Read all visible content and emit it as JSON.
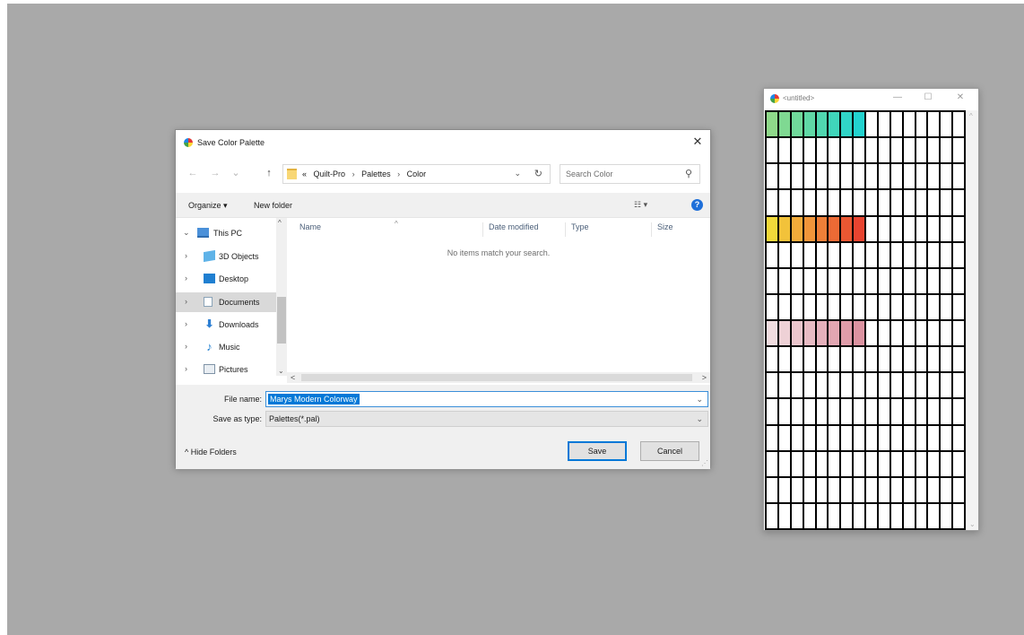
{
  "dialog": {
    "title": "Save Color Palette",
    "close_glyph": "✕",
    "nav": {
      "back": "←",
      "forward": "→",
      "recent": "⌄",
      "up": "↑"
    },
    "address": {
      "overflow": "«",
      "crumbs": [
        "Quilt-Pro",
        "Palettes",
        "Color"
      ],
      "sep": "›",
      "dropdown_glyph": "⌄",
      "refresh_glyph": "↻"
    },
    "search": {
      "placeholder": "Search Color",
      "icon_glyph": "⚲"
    },
    "toolbar": {
      "organize": "Organize ▾",
      "new_folder": "New folder",
      "view_glyph": "☷ ▾",
      "help_glyph": "?"
    },
    "tree": [
      {
        "label": "This PC",
        "chevron": "⌄",
        "icon": "computer-icon"
      },
      {
        "label": "3D Objects",
        "chevron": "›",
        "icon": "cube-icon"
      },
      {
        "label": "Desktop",
        "chevron": "›",
        "icon": "desktop-icon"
      },
      {
        "label": "Documents",
        "chevron": "›",
        "icon": "document-icon",
        "selected": true
      },
      {
        "label": "Downloads",
        "chevron": "›",
        "icon": "download-icon"
      },
      {
        "label": "Music",
        "chevron": "›",
        "icon": "music-icon"
      },
      {
        "label": "Pictures",
        "chevron": "›",
        "icon": "pictures-icon"
      }
    ],
    "columns": {
      "name": "Name",
      "date": "Date modified",
      "type": "Type",
      "size": "Size",
      "sort_glyph": "^"
    },
    "empty_message": "No items match your search.",
    "scroll": {
      "up": "^",
      "down": "⌄",
      "left": "<",
      "right": ">"
    },
    "file_name": {
      "label": "File name:",
      "value": "Marys Modern Colorway",
      "caret": "⌄"
    },
    "save_type": {
      "label": "Save as type:",
      "value": "Palettes(*.pal)",
      "caret": "⌄"
    },
    "hide_folders": "^  Hide Folders",
    "save_label": "Save",
    "cancel_label": "Cancel",
    "grip": "⋰"
  },
  "palette_window": {
    "title": "<untitled>",
    "minimize": "—",
    "maximize": "☐",
    "close": "✕",
    "scroll_up": "^",
    "scroll_down": "⌄",
    "grid_size": 16,
    "colors": {
      "row0": [
        "#8fd98a",
        "#7fd992",
        "#70d99b",
        "#60d8a6",
        "#50d7b0",
        "#40d6bb",
        "#30d5c7",
        "#22d3cf"
      ],
      "row4": [
        "#f2d93a",
        "#f2c23a",
        "#f2ab3a",
        "#f0953a",
        "#ee7f38",
        "#ec6a35",
        "#ea5732",
        "#e84430"
      ],
      "row8": [
        "#f1dde0",
        "#eed1d6",
        "#ebc6cd",
        "#e8bbc4",
        "#e5b0bb",
        "#e2a6b2",
        "#df9ca9",
        "#dc93a1"
      ]
    }
  }
}
